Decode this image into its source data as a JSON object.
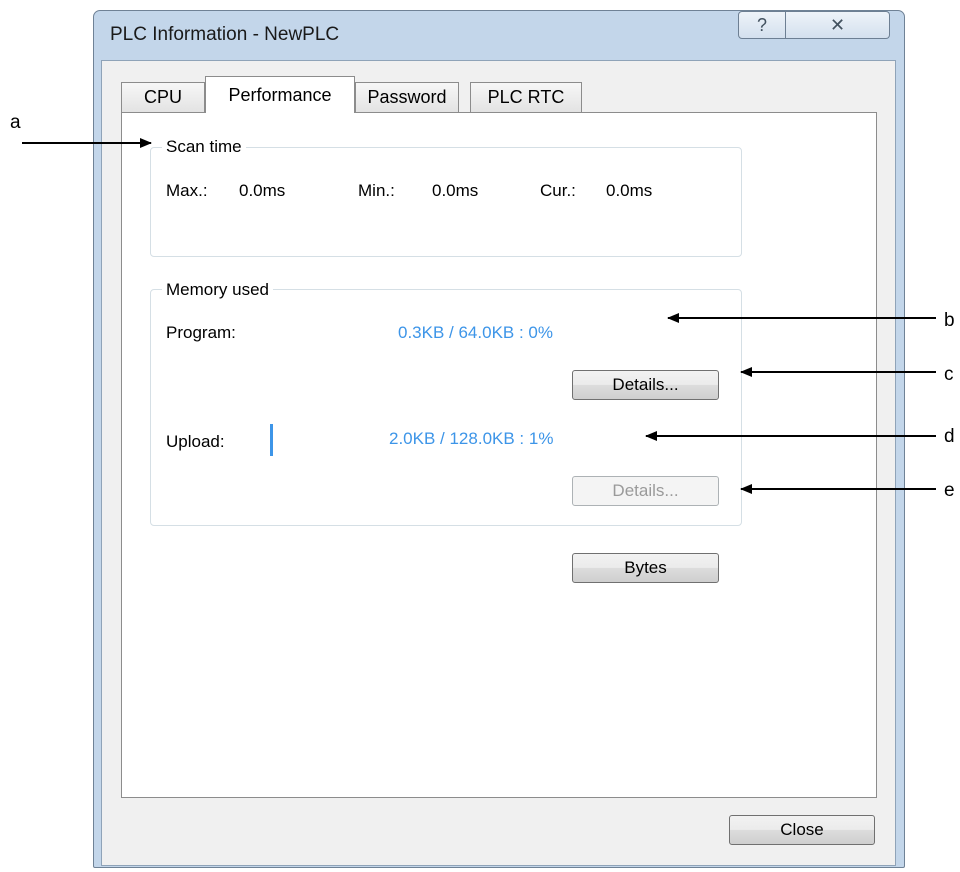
{
  "window": {
    "title": "PLC Information - NewPLC",
    "help_glyph": "?",
    "close_glyph": "✕"
  },
  "tabs": [
    {
      "label": "CPU"
    },
    {
      "label": "Performance",
      "active": true
    },
    {
      "label": "Password"
    },
    {
      "label": "PLC RTC"
    }
  ],
  "scan_time": {
    "title": "Scan time",
    "max_label": "Max.:",
    "max_value": "0.0ms",
    "min_label": "Min.:",
    "min_value": "0.0ms",
    "cur_label": "Cur.:",
    "cur_value": "0.0ms"
  },
  "memory_used": {
    "title": "Memory used",
    "program_label": "Program:",
    "program_value": "0.3KB / 64.0KB : 0%",
    "program_details_label": "Details...",
    "upload_label": "Upload:",
    "upload_value": "2.0KB / 128.0KB : 1%",
    "upload_percent": 1,
    "upload_details_label": "Details..."
  },
  "bytes_button_label": "Bytes",
  "close_button_label": "Close",
  "callouts": {
    "a": "a",
    "b": "b",
    "c": "c",
    "d": "d",
    "e": "e"
  },
  "colors": {
    "accent_blue": "#3d95e8",
    "frame": "#c3d6ea"
  }
}
